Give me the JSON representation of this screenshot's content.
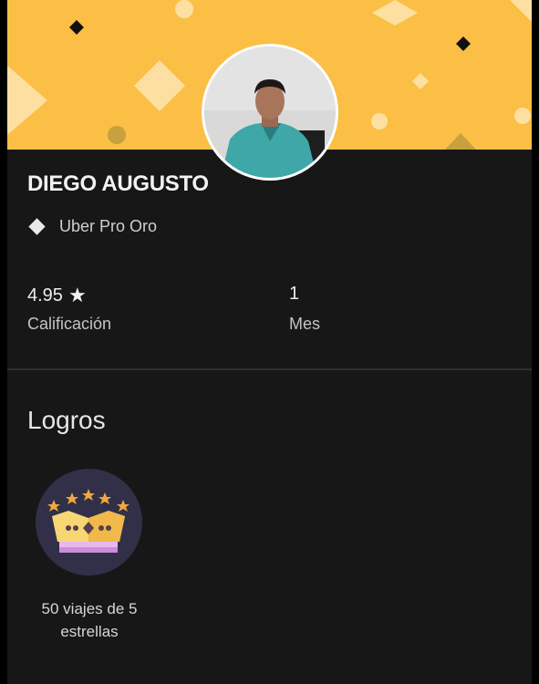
{
  "profile": {
    "name": "DIEGO AUGUSTO",
    "tier": "Uber Pro Oro",
    "tier_icon": "diamond-icon"
  },
  "stats": {
    "rating_value": "4.95",
    "rating_icon": "star-icon",
    "rating_label": "Calificación",
    "months_value": "1",
    "months_label": "Mes"
  },
  "achievements": {
    "title": "Logros",
    "items": [
      {
        "label": "50 viajes de 5 estrellas",
        "icon": "crown-icon"
      }
    ]
  },
  "colors": {
    "header_yellow": "#fbbf45",
    "background": "#171717",
    "badge_bg": "#323049"
  }
}
